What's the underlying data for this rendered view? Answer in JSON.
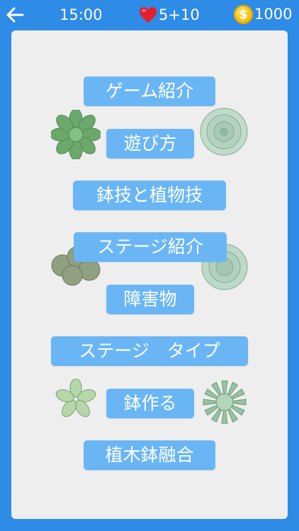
{
  "topbar": {
    "time": "15:00",
    "lives": "5+10",
    "coin_symbol": "$",
    "coins": "1000"
  },
  "menu": {
    "game_intro": "ゲーム紹介",
    "how_to_play": "遊び方",
    "pot_plant_skills": "鉢技と植物技",
    "stage_intro": "ステージ紹介",
    "obstacles": "障害物",
    "stage_type": "ステージ　タイプ",
    "make_pot": "鉢作る",
    "pot_fusion": "植木鉢融合"
  },
  "colors": {
    "header_bg": "#2e8be6",
    "panel_bg": "#eeeeee",
    "button_bg": "#6ab6f5",
    "text": "#ffffff"
  },
  "icons": [
    "back-arrow-icon",
    "heart-icon",
    "coin-icon",
    "succulent-plant"
  ]
}
